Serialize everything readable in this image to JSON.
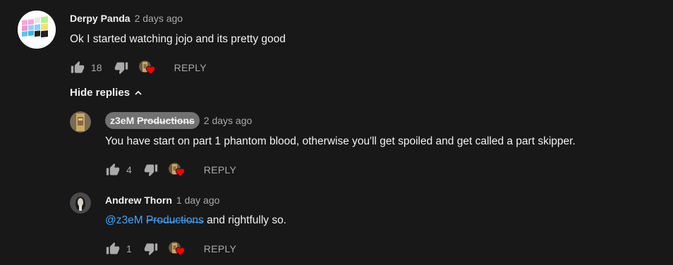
{
  "comment": {
    "author": "Derpy Panda",
    "timestamp": "2 days ago",
    "text": "Ok I started watching jojo and its pretty good",
    "likes": "18",
    "reply_label": "REPLY"
  },
  "hide_replies_label": "Hide replies",
  "replies": [
    {
      "author": "z3eM Productions",
      "author_plain": "z3eM",
      "author_struck": "Productions",
      "timestamp": "2 days ago",
      "text": "You have start on part 1 phantom blood, otherwise you'll get spoiled and get called a part skipper.",
      "likes": "4",
      "reply_label": "REPLY"
    },
    {
      "author": "Andrew Thorn",
      "timestamp": "1 day ago",
      "mention_plain": "@z3eM",
      "mention_struck": "Productions",
      "text": "and rightfully so.",
      "likes": "1",
      "reply_label": "REPLY"
    }
  ],
  "colors": {
    "background": "#181818",
    "text_primary": "#f1f1f1",
    "text_secondary": "#aaaaaa",
    "mention": "#3ea6ff",
    "heart": "#ff0000",
    "author_chip": "#717171"
  },
  "icons": [
    "thumbs-up-icon",
    "thumbs-down-icon",
    "creator-heart-icon",
    "chevron-up-icon",
    "user-avatar"
  ]
}
